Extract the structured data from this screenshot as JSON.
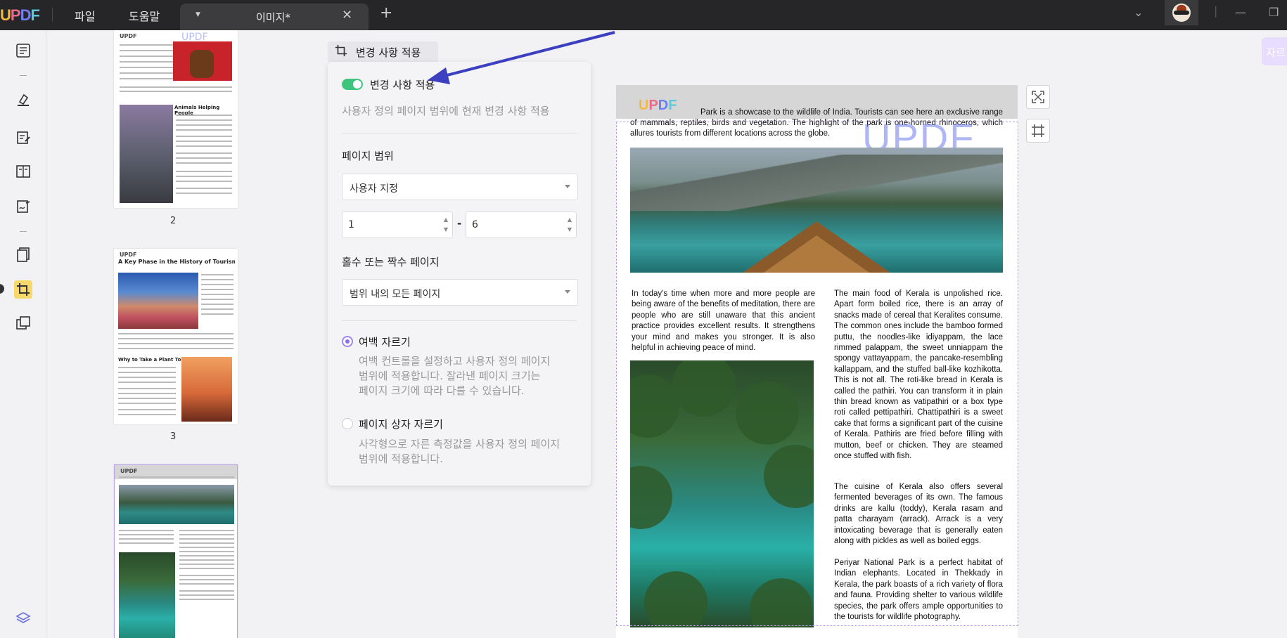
{
  "app": {
    "logo": "UPDF",
    "menu_file": "파일",
    "menu_help": "도움말",
    "tab_title": "이미지*"
  },
  "panel": {
    "header_label": "변경 사항 적용",
    "toggle_label": "변경 사항 적용",
    "toggle_desc": "사용자 정의 페이지 범위에 현재 변경 사항 적용",
    "page_range_title": "페이지 범위",
    "page_range_value": "사용자 지정",
    "range_from": "1",
    "range_dash": "-",
    "range_to": "6",
    "odd_even_title": "홀수 또는 짝수 페이지",
    "odd_even_value": "범위 내의 모든 페이지",
    "option1_label": "여백 자르기",
    "option1_desc_1": "여백 컨트롤을 설정하고 사용자 정의 페이지",
    "option1_desc_2": "범위에 적용합니다. 잘라낸 페이지 크기는",
    "option1_desc_3": "페이지 크기에 따라 다를 수 있습니다.",
    "option2_label": "페이지 상자 자르기",
    "option2_desc_1": "사각형으로 자른 측정값을 사용자 정의 페이지",
    "option2_desc_2": "범위에 적용합니다."
  },
  "thumbnails": {
    "page2": "2",
    "page3": "3",
    "page3_title": "A Key Phase in the History of Tourism",
    "page2_heading": "Animals Helping People",
    "page3_heading": "Why to Take a Plant Tour"
  },
  "page": {
    "logo": "UPDF",
    "watermark": "UPDF",
    "head_text": "Park is a showcase to the wildlife of India. Tourists can see here an exclusive range of mammals, reptiles, birds and vegetation. The highlight of the park is one-horned rhinoceros, which allures tourists from different locations across the globe.",
    "col_left": "In today's time when more and more people are being aware of the benefits of meditation, there are people who are still unaware that this ancient practice provides excellent results. It strengthens your mind and makes you stronger. It is also helpful in achieving peace of mind.",
    "col_right_1": "The main food of Kerala is unpolished rice. Apart form boiled rice, there is an array of snacks made of cereal that Keralites consume. The common ones include the bamboo formed puttu, the noodles-like idiyappam, the lace rimmed palappam, the sweet unniappam the spongy vattayappam, the pancake-resembling kallappam, and the stuffed ball-like kozhikotta. This is not all. The roti-like bread in Kerala is called the pathiri. You can transform it in plain thin bread known as vatipathiri or a box type roti called pettipathiri. Chattipathiri is a sweet cake that forms a significant part of the cuisine of Kerala. Pathiris are fried before filling with mutton, beef or chicken. They are steamed once stuffed with fish.",
    "col_right_2": "The cuisine of Kerala also offers several fermented beverages of its own. The famous drinks are kallu (toddy), Kerala rasam and patta charayam (arrack). Arrack is a very intoxicating beverage that is generally eaten along with pickles as well as boiled eggs.",
    "col_right_3": "Periyar National Park is a perfect habitat of Indian elephants. Located in Thekkady in Kerala, the park boasts of a rich variety of flora and fauna. Providing shelter to various wildlife species, the park offers ample opportunities to the tourists for wildlife photography."
  },
  "right_pill": "자르",
  "colors": {
    "accent": "#8a6ff0",
    "toggle_on": "#3fc47e",
    "titlebar": "#262628"
  }
}
